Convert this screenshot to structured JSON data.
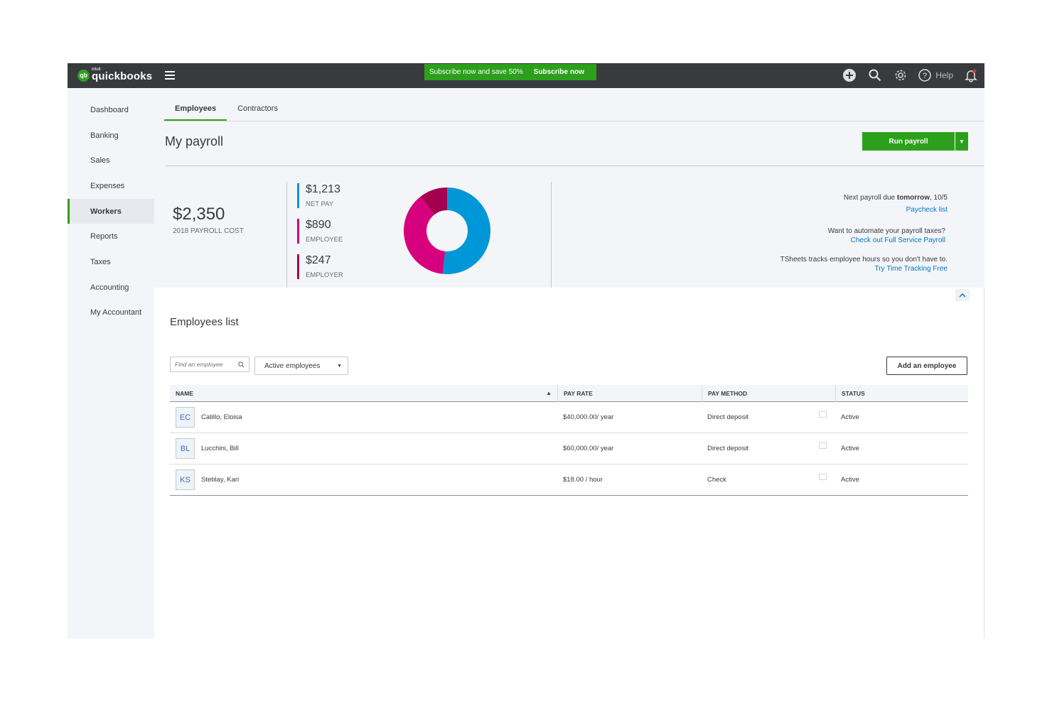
{
  "topbar": {
    "logo_intuit": "intuit",
    "logo_text": "quickbooks",
    "logo_mark": "qb",
    "promo_text": "Subscribe now and save 50%",
    "promo_button": "Subscribe now",
    "help_label": "Help",
    "icons": [
      "plus-circle-icon",
      "search-icon",
      "gear-icon",
      "help-icon",
      "bell-icon"
    ]
  },
  "sidebar": {
    "items": [
      {
        "label": "Dashboard"
      },
      {
        "label": "Banking"
      },
      {
        "label": "Sales"
      },
      {
        "label": "Expenses"
      },
      {
        "label": "Workers",
        "active": true
      },
      {
        "label": "Reports"
      },
      {
        "label": "Taxes"
      },
      {
        "label": "Accounting"
      },
      {
        "label": "My Accountant"
      }
    ]
  },
  "tabs": [
    {
      "label": "Employees",
      "active": true
    },
    {
      "label": "Contractors"
    }
  ],
  "page_title": "My payroll",
  "run_payroll": {
    "label": "Run payroll",
    "caret": "▼"
  },
  "summary": {
    "total_amount": "$2,350",
    "total_label": "2018 PAYROLL COST",
    "breakdown": [
      {
        "amount": "$1,213",
        "label": "NET PAY",
        "color": "#0097d8",
        "value": 1213
      },
      {
        "amount": "$890",
        "label": "EMPLOYEE",
        "color": "#d6007e",
        "value": 890
      },
      {
        "amount": "$247",
        "label": "EMPLOYER",
        "color": "#a3004f",
        "value": 247
      }
    ]
  },
  "info": {
    "next_payroll_prefix": "Next payroll due ",
    "next_payroll_bold": "tomorrow",
    "next_payroll_suffix": ", 10/5",
    "paycheck_link": "Paycheck list",
    "automate_text": "Want to automate your payroll taxes?",
    "automate_link": "Check out Full Service Payroll",
    "tsheets_text": "TSheets tracks employee hours so you don't have to.",
    "tsheets_link": "Try Time Tracking Free"
  },
  "list": {
    "title": "Employees list",
    "search_placeholder": "Find an employee",
    "filter_value": "Active employees",
    "add_button": "Add an employee",
    "columns": {
      "name": "NAME",
      "rate": "PAY RATE",
      "method": "PAY METHOD",
      "status": "STATUS"
    },
    "rows": [
      {
        "initials": "EC",
        "name": "Catillo, Eloisa",
        "rate": "$40,000.00/ year",
        "method": "Direct deposit",
        "status": "Active"
      },
      {
        "initials": "BL",
        "name": "Lucchini, Bill",
        "rate": "$60,000.00/ year",
        "method": "Direct deposit",
        "status": "Active"
      },
      {
        "initials": "KS",
        "name": "Steblay, Kari",
        "rate": "$18.00 / hour",
        "method": "Check",
        "status": "Active"
      }
    ]
  }
}
